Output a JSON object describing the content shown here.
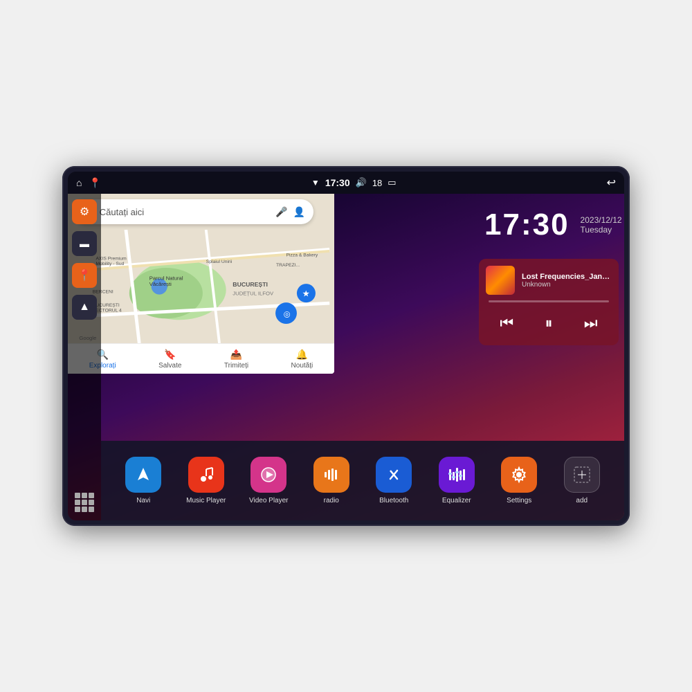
{
  "device": {
    "status_bar": {
      "wifi_icon": "▼",
      "time": "17:30",
      "volume_icon": "🔊",
      "battery_level": "18",
      "battery_icon": "🔋",
      "back_icon": "↩"
    },
    "sidebar": {
      "settings_label": "Settings",
      "files_label": "Files",
      "maps_label": "Maps",
      "navigation_label": "Navigation",
      "apps_label": "Apps"
    },
    "map": {
      "search_placeholder": "Căutați aici",
      "bottom_items": [
        {
          "label": "Explorați",
          "active": true
        },
        {
          "label": "Salvate",
          "active": false
        },
        {
          "label": "Trimiteți",
          "active": false
        },
        {
          "label": "Noutăți",
          "active": false
        }
      ]
    },
    "clock": {
      "time": "17:30",
      "date": "2023/12/12",
      "day": "Tuesday"
    },
    "music": {
      "title": "Lost Frequencies_Janie...",
      "artist": "Unknown",
      "album_art": "🎵"
    },
    "apps": [
      {
        "id": "navi",
        "label": "Navi",
        "icon": "▲",
        "bg": "bg-blue"
      },
      {
        "id": "music-player",
        "label": "Music Player",
        "icon": "♪",
        "bg": "bg-red"
      },
      {
        "id": "video-player",
        "label": "Video Player",
        "icon": "▶",
        "bg": "bg-pink"
      },
      {
        "id": "radio",
        "label": "radio",
        "icon": "📻",
        "bg": "bg-orange"
      },
      {
        "id": "bluetooth",
        "label": "Bluetooth",
        "icon": "⚡",
        "bg": "bg-blue2"
      },
      {
        "id": "equalizer",
        "label": "Equalizer",
        "icon": "🎚",
        "bg": "bg-purple"
      },
      {
        "id": "settings",
        "label": "Settings",
        "icon": "⚙",
        "bg": "bg-orange2"
      },
      {
        "id": "add",
        "label": "add",
        "icon": "+",
        "bg": "bg-gray"
      }
    ]
  }
}
